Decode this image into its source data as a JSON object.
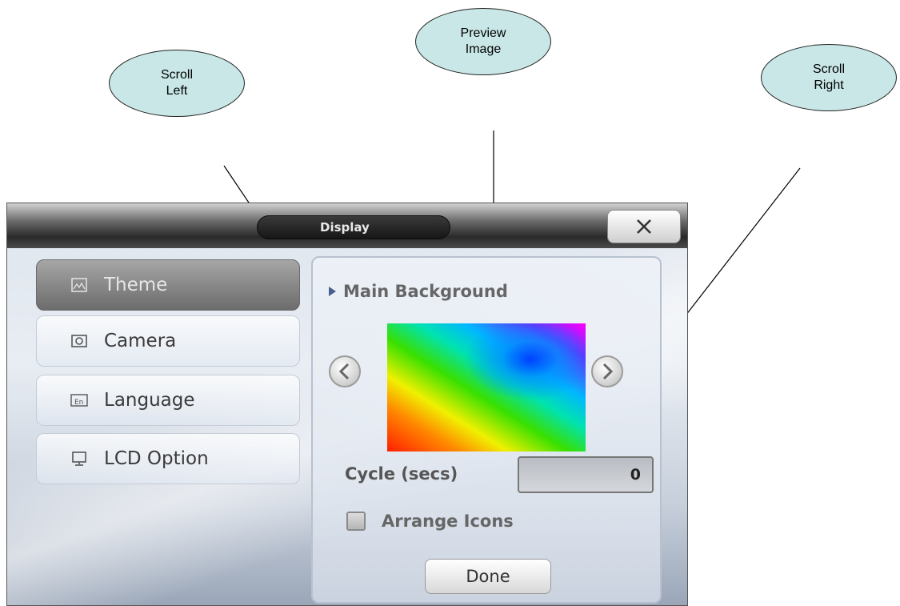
{
  "callouts": {
    "scroll_left": "Scroll\nLeft",
    "preview_image": "Preview\nImage",
    "scroll_right": "Scroll\nRight"
  },
  "window": {
    "title": "Display",
    "close_icon": "x-icon"
  },
  "sidebar": {
    "items": [
      {
        "label": "Theme",
        "icon": "image-icon",
        "active": true
      },
      {
        "label": "Camera",
        "icon": "camera-icon",
        "active": false
      },
      {
        "label": "Language",
        "icon": "language-icon",
        "active": false
      },
      {
        "label": "LCD Option",
        "icon": "monitor-icon",
        "active": false
      }
    ]
  },
  "main": {
    "section_title": "Main Background",
    "cycle_label": "Cycle (secs)",
    "cycle_value": "0",
    "arrange_label": "Arrange Icons",
    "arrange_checked": false,
    "done_label": "Done"
  },
  "colors": {
    "callout_fill": "#c9e7e7",
    "section_marker": "#4b5f8d"
  }
}
